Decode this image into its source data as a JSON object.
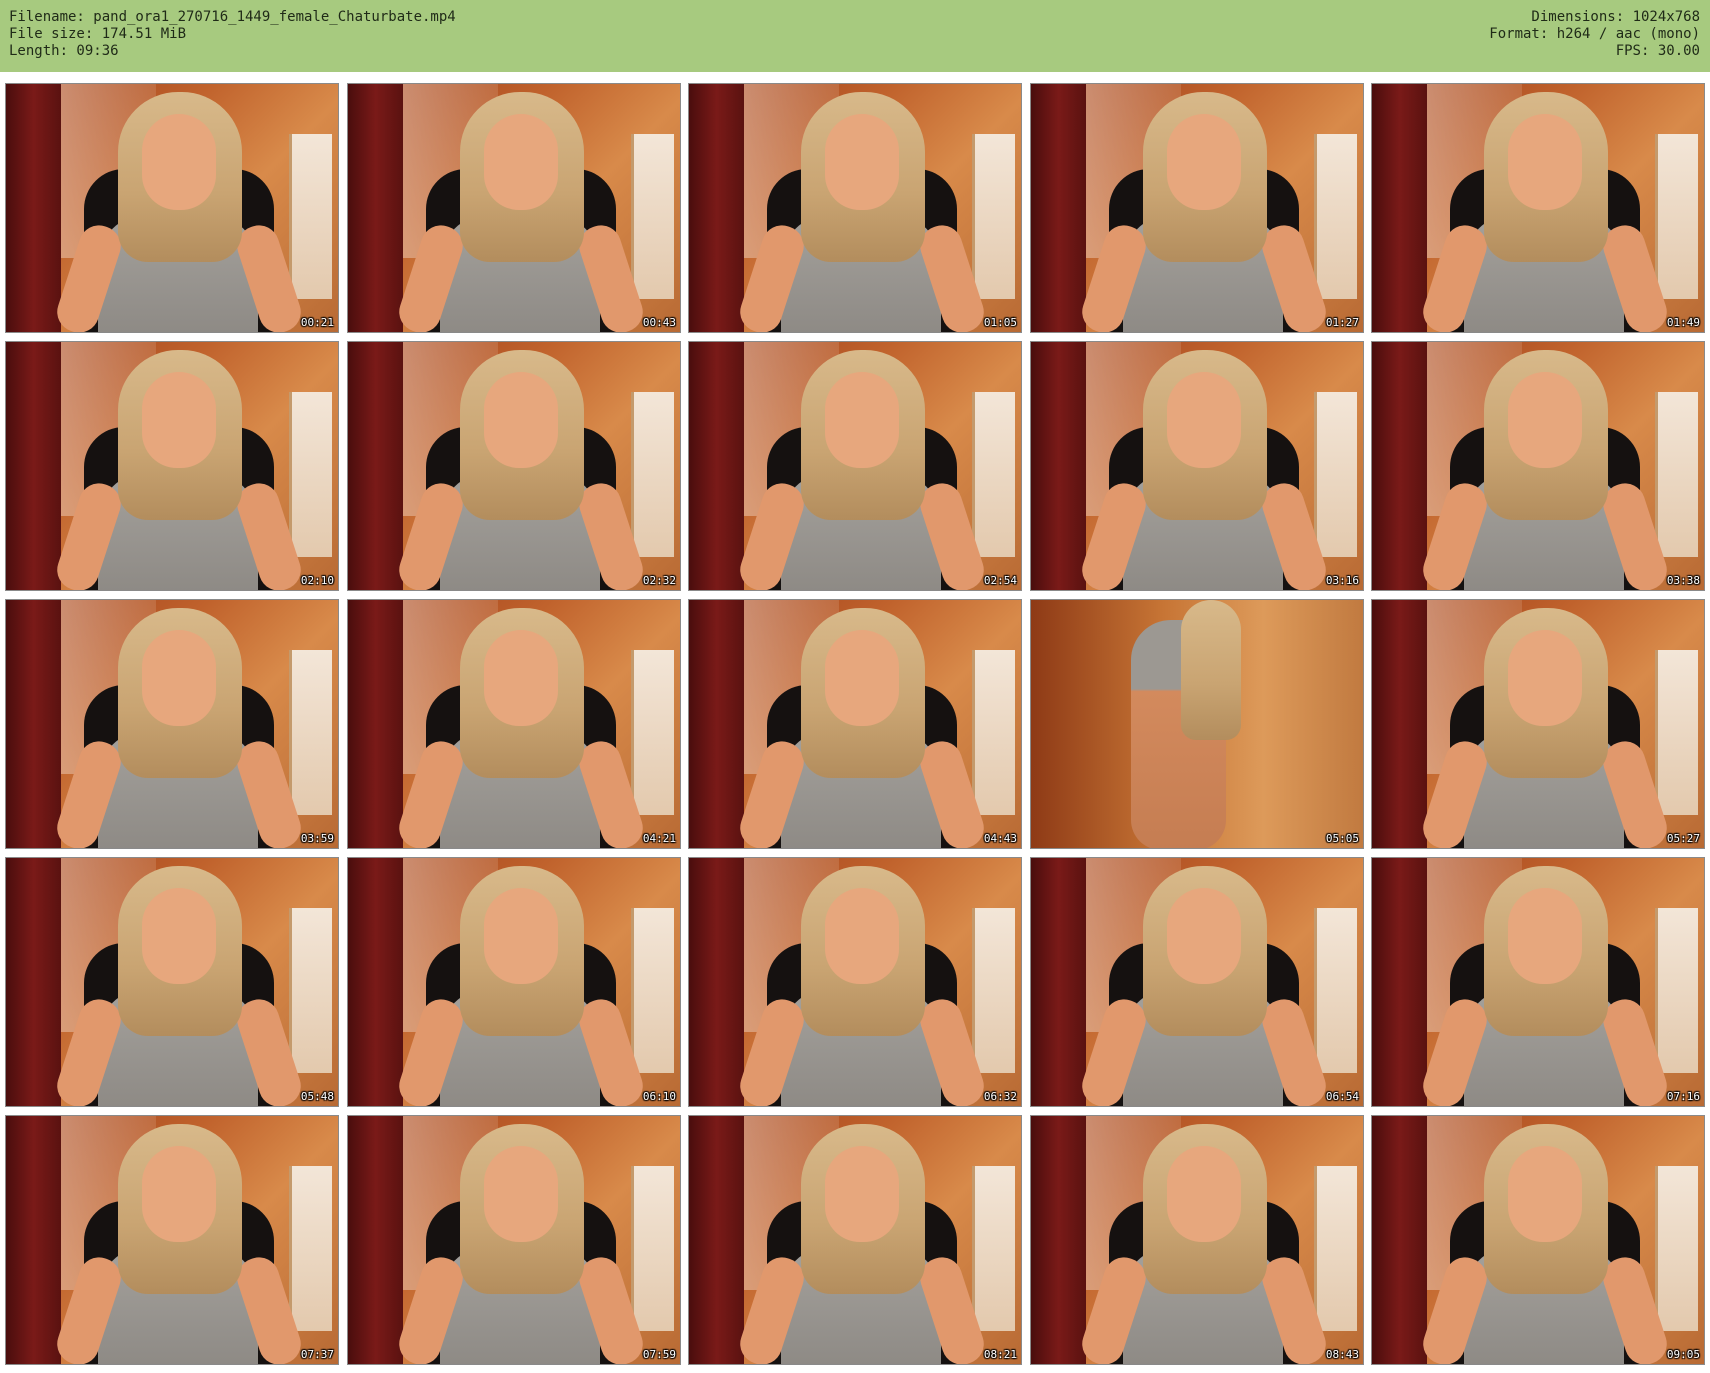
{
  "header": {
    "filename": "Filename: pand_ora1_270716_1449_female_Chaturbate.mp4",
    "filesize": "File size: 174.51 MiB",
    "length": "Length: 09:36",
    "dimensions": "Dimensions: 1024x768",
    "format": "Format: h264 / aac (mono)",
    "fps": "FPS: 30.00"
  },
  "colors": {
    "header_bg": "#a7ca7f",
    "page_bg": "#ffffff"
  },
  "thumbnails": [
    {
      "time": "00:21"
    },
    {
      "time": "00:43"
    },
    {
      "time": "01:05"
    },
    {
      "time": "01:27"
    },
    {
      "time": "01:49"
    },
    {
      "time": "02:10"
    },
    {
      "time": "02:32"
    },
    {
      "time": "02:54"
    },
    {
      "time": "03:16"
    },
    {
      "time": "03:38"
    },
    {
      "time": "03:59"
    },
    {
      "time": "04:21"
    },
    {
      "time": "04:43"
    },
    {
      "time": "05:05"
    },
    {
      "time": "05:27"
    },
    {
      "time": "05:48"
    },
    {
      "time": "06:10"
    },
    {
      "time": "06:32"
    },
    {
      "time": "06:54"
    },
    {
      "time": "07:16"
    },
    {
      "time": "07:37"
    },
    {
      "time": "07:59"
    },
    {
      "time": "08:21"
    },
    {
      "time": "08:43"
    },
    {
      "time": "09:05"
    }
  ]
}
